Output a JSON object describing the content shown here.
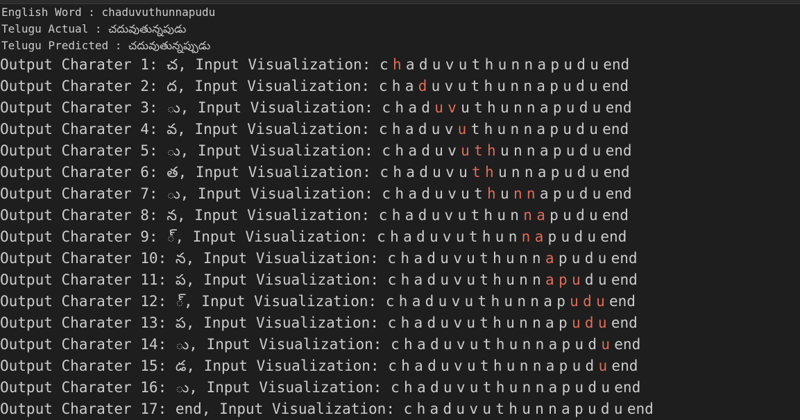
{
  "header": {
    "english_label": "English Word : ",
    "english_value": "chaduvuthunnapudu",
    "actual_label": "Telugu Actual : ",
    "actual_value": "చదువుతున్నపుడు",
    "predicted_label": "Telugu Predicted : ",
    "predicted_value": "చదువుతున్నప్పుడు"
  },
  "input_tokens": [
    "c",
    "h",
    "a",
    "d",
    "u",
    "v",
    "u",
    "t",
    "h",
    "u",
    "n",
    "n",
    "a",
    "p",
    "u",
    "d",
    "u",
    "end"
  ],
  "rows": [
    {
      "prefix": "Output Charater 1: ",
      "char": "చ",
      "mid": ", Input Visualization: ",
      "hl": [
        1
      ]
    },
    {
      "prefix": "Output Charater 2: ",
      "char": "ద",
      "mid": ", Input Visualization: ",
      "hl": [
        3
      ]
    },
    {
      "prefix": "Output Charater 3: ",
      "char": "ు",
      "mid": ", Input Visualization: ",
      "hl": [
        4,
        5
      ]
    },
    {
      "prefix": "Output Charater 4: ",
      "char": "వ",
      "mid": ", Input Visualization: ",
      "hl": [
        6
      ]
    },
    {
      "prefix": "Output Charater 5: ",
      "char": "ు",
      "mid": ", Input Visualization: ",
      "hl": [
        6,
        7,
        8
      ]
    },
    {
      "prefix": "Output Charater 6: ",
      "char": "త",
      "mid": ", Input Visualization: ",
      "hl": [
        7,
        8
      ]
    },
    {
      "prefix": "Output Charater 7: ",
      "char": "ు",
      "mid": ", Input Visualization: ",
      "hl": [
        8,
        10,
        11
      ]
    },
    {
      "prefix": "Output Charater 8: ",
      "char": "న",
      "mid": ", Input Visualization: ",
      "hl": [
        11,
        12
      ]
    },
    {
      "prefix": "Output Charater 9: ",
      "char": "్",
      "mid": ", Input Visualization: ",
      "hl": [
        11,
        12
      ]
    },
    {
      "prefix": "Output Charater 10: ",
      "char": "న",
      "mid": ", Input Visualization: ",
      "hl": [
        12
      ]
    },
    {
      "prefix": "Output Charater 11: ",
      "char": "ప",
      "mid": ", Input Visualization: ",
      "hl": [
        12,
        13,
        14
      ]
    },
    {
      "prefix": "Output Charater 12: ",
      "char": "్",
      "mid": ", Input Visualization: ",
      "hl": [
        14,
        15,
        16
      ]
    },
    {
      "prefix": "Output Charater 13: ",
      "char": "ప",
      "mid": ", Input Visualization: ",
      "hl": [
        14,
        15,
        16
      ]
    },
    {
      "prefix": "Output Charater 14: ",
      "char": "ు",
      "mid": ", Input Visualization: ",
      "hl": [
        16
      ]
    },
    {
      "prefix": "Output Charater 15: ",
      "char": "డ",
      "mid": ", Input Visualization: ",
      "hl": [
        16
      ]
    },
    {
      "prefix": "Output Charater 16: ",
      "char": "ు",
      "mid": ", Input Visualization: ",
      "hl": []
    },
    {
      "prefix": "Output Charater 17: ",
      "char": "end",
      "mid": ", Input Visualization: ",
      "hl": []
    }
  ],
  "colors": {
    "background": "#1e1e1e",
    "text": "#cccccc",
    "highlight": "#e06c5b"
  }
}
